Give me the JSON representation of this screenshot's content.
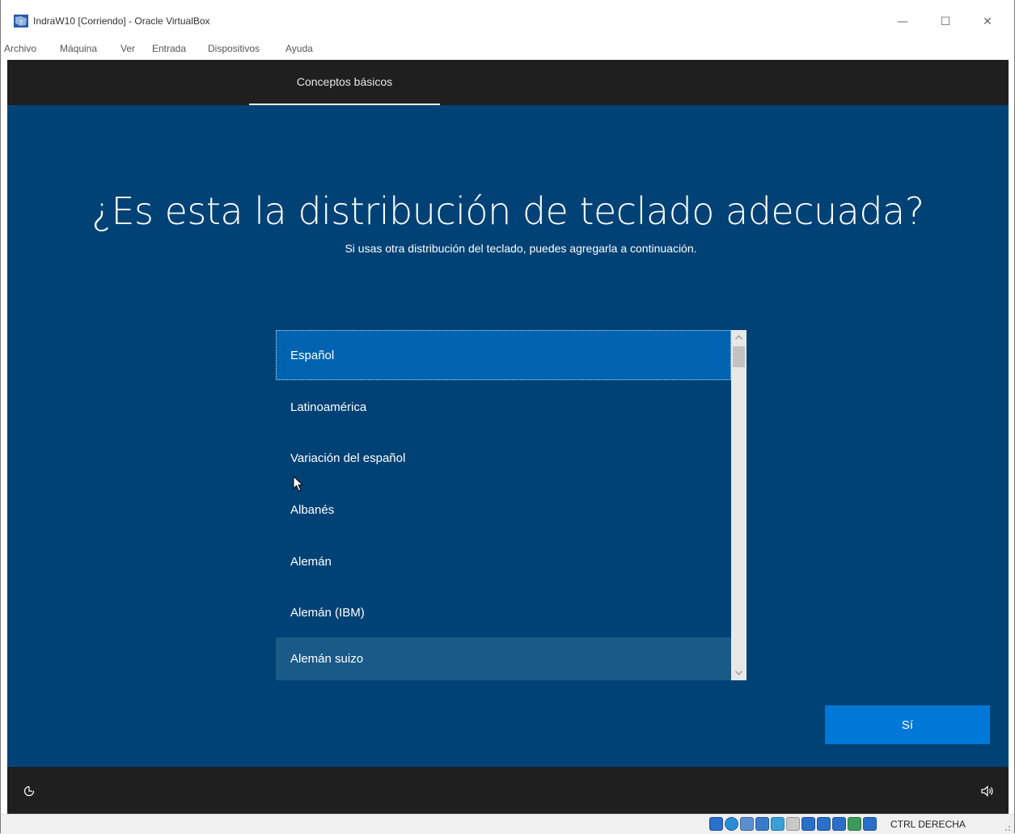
{
  "window": {
    "title": "IndraW10 [Corriendo] - Oracle VirtualBox",
    "minimize_glyph": "—",
    "maximize_glyph": "☐",
    "close_glyph": "✕"
  },
  "menubar": {
    "items": [
      "Archivo",
      "Máquina",
      "Ver",
      "Entrada",
      "Dispositivos",
      "Ayuda"
    ]
  },
  "oobe": {
    "tab_label": "Conceptos básicos",
    "headline": "¿Es esta la distribución de teclado adecuada?",
    "subtitle": "Si usas otra distribución del teclado, puedes agregarla a continuación.",
    "layouts": [
      "Español",
      "Latinoamérica",
      "Variación del español",
      "Albanés",
      "Alemán",
      "Alemán (IBM)",
      "Alemán suizo"
    ],
    "selected_index": 0,
    "hovered_index": 6,
    "yes_button": "Sí"
  },
  "statusbar": {
    "host_key": "CTRL DERECHA",
    "icons": [
      "hard-disk-icon",
      "optical-drive-icon",
      "audio-icon",
      "network-icon",
      "usb-icon",
      "shared-folders-icon",
      "display-icon",
      "recording-icon",
      "cpu-icon",
      "mouse-integration-icon",
      "host-key-icon"
    ],
    "icon_colors": [
      "#2a6fc9",
      "#2a8bd6",
      "#5a8fcf",
      "#3a7cc9",
      "#3aa0d8",
      "#c8c8c8",
      "#2a6fc9",
      "#2a6fc9",
      "#2a6fc9",
      "#3a9a5a",
      "#2a6fc9"
    ]
  },
  "colors": {
    "oobe_background": "#004275",
    "selected_item": "#0063b1",
    "primary_button": "#0078d7",
    "bar_background": "#1f1f1f"
  }
}
